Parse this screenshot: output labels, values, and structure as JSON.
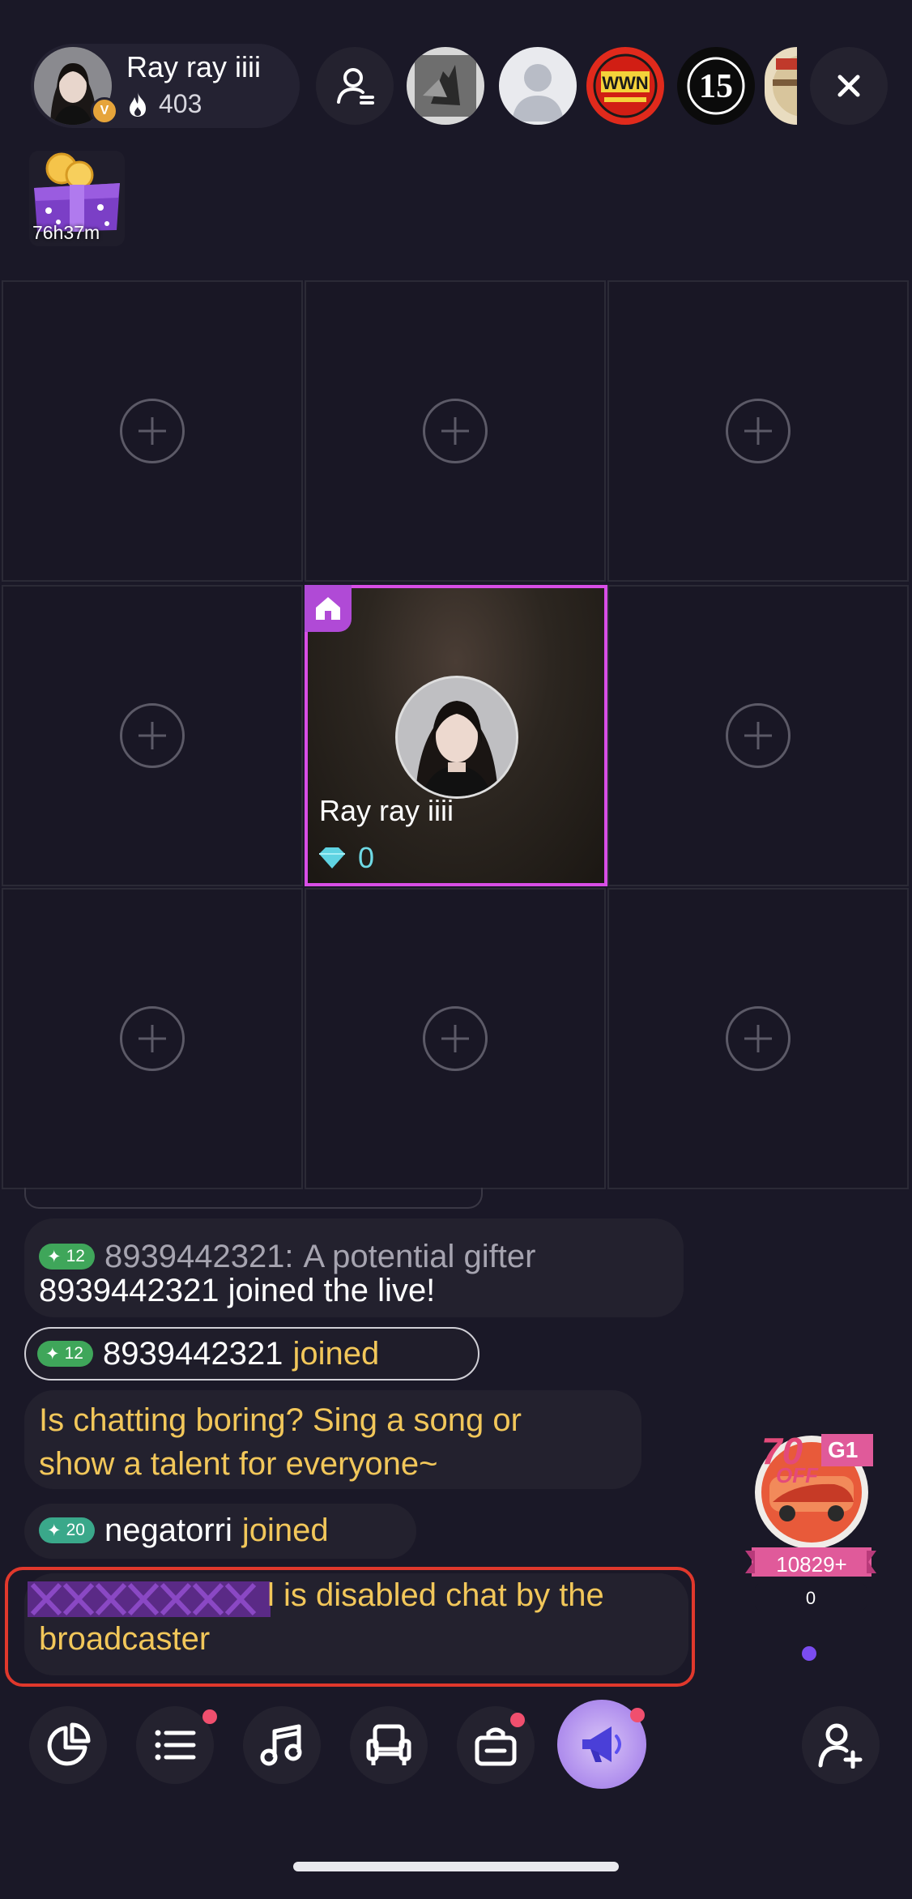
{
  "host": {
    "name": "Ray ray iiii",
    "count": "403",
    "badge": "V"
  },
  "viewers": [
    {
      "name": "viewer-1"
    },
    {
      "name": "viewer-2"
    },
    {
      "name": "viewer-3",
      "label": "WWN"
    },
    {
      "name": "viewer-4",
      "label": "15"
    },
    {
      "name": "viewer-5"
    }
  ],
  "gift_timer": "76h37m",
  "seat": {
    "name": "Ray ray iiii",
    "diamonds": "0"
  },
  "chat": {
    "msg1_level": "12",
    "msg1_user": "8939442321:",
    "msg1_text": "A potential gifter",
    "msg1_line2": "8939442321 joined the live!",
    "msg2_level": "12",
    "msg2_user": "8939442321",
    "msg2_action": "joined",
    "msg3_line1": "Is chatting boring? Sing a song or",
    "msg3_line2": "show a talent for everyone~",
    "msg4_level": "20",
    "msg4_user": "negatorri",
    "msg4_action": "joined",
    "msg5_line1": "l is disabled chat by the",
    "msg5_line2": "broadcaster"
  },
  "promo": {
    "discount": "70",
    "off": "OFF",
    "tag": "G1",
    "price": "10829+",
    "count": "0"
  },
  "colors": {
    "background": "#1a1827",
    "seat_border": "#d84ee6",
    "accent_gold": "#f2c75a",
    "diamond": "#6fd9e5",
    "highlight": "#e0382c"
  }
}
